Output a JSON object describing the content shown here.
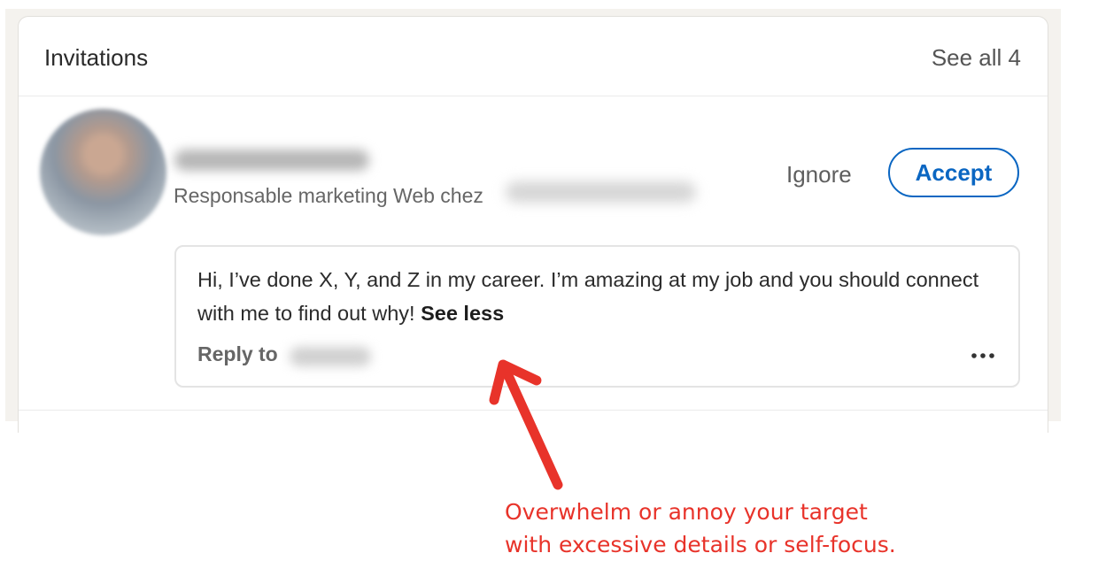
{
  "header": {
    "title": "Invitations",
    "see_all_label": "See all 4"
  },
  "invitation": {
    "headline": "Responsable marketing Web chez",
    "ignore_label": "Ignore",
    "accept_label": "Accept",
    "message": "Hi, I’ve done X, Y, and Z in my career. I’m amazing at my job and you should connect with me to find out why!",
    "see_less_label": "See less",
    "reply_label": "Reply to",
    "more_icon": "more-horizontal-icon"
  },
  "annotation": {
    "line1": "Overwhelm or annoy your target",
    "line2": "with excessive details or self-focus.",
    "color": "#e8332a"
  },
  "colors": {
    "accent": "#0a66c2",
    "page_background": "#f4f2ee"
  }
}
